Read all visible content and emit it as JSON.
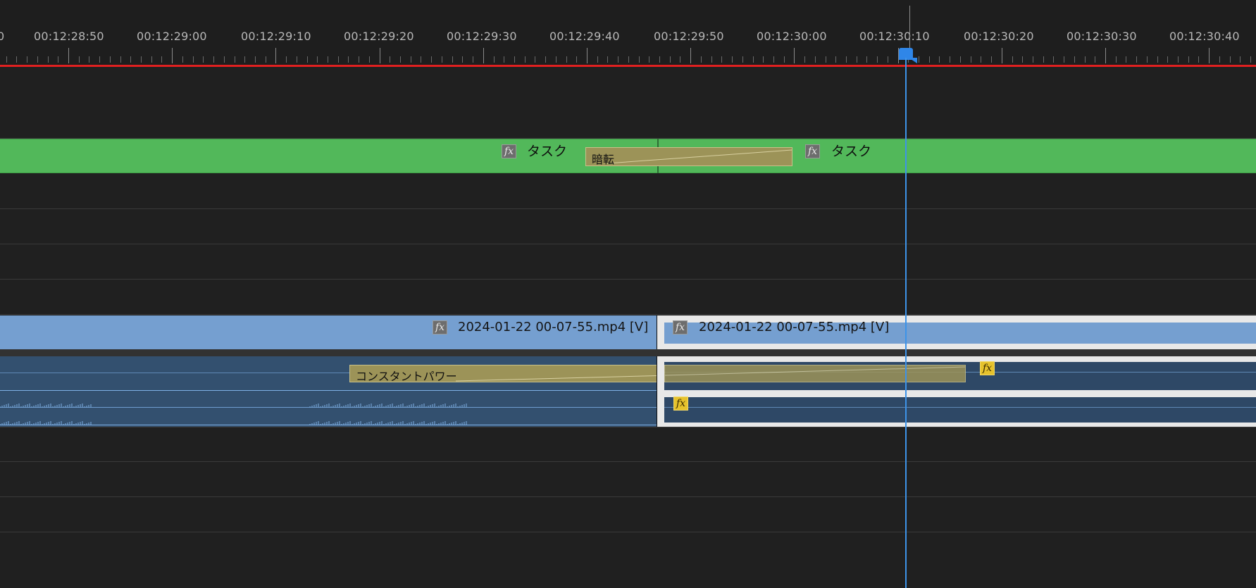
{
  "ruler": {
    "timecodes": [
      "0",
      "00:12:28:50",
      "00:12:29:00",
      "00:12:29:10",
      "00:12:29:20",
      "00:12:29:30",
      "00:12:29:40",
      "00:12:29:50",
      "00:12:30:00",
      "00:12:30:10",
      "00:12:30:20",
      "00:12:30:30",
      "00:12:30:40"
    ]
  },
  "graphics_track": {
    "clip1_label": "タスク",
    "clip2_label": "タスク",
    "transition_label": "暗転",
    "fx_symbol": "fx"
  },
  "video_track": {
    "clip1_label": "2024-01-22 00-07-55.mp4 [V]",
    "clip2_label": "2024-01-22 00-07-55.mp4 [V]",
    "fx_symbol": "fx"
  },
  "audio_track": {
    "transition_label": "コンスタントパワー",
    "fx_symbol": "fx"
  },
  "colors": {
    "graphics_clip": "#52b85a",
    "video_clip": "#759fd0",
    "audio_clip": "#33506f",
    "playhead": "#3d93e8",
    "work_area_bar": "#e02020",
    "fx_active": "#e6c22c"
  },
  "icons": {
    "fx_badge": "fx-badge-icon",
    "playhead_handle": "playhead-handle-icon"
  }
}
